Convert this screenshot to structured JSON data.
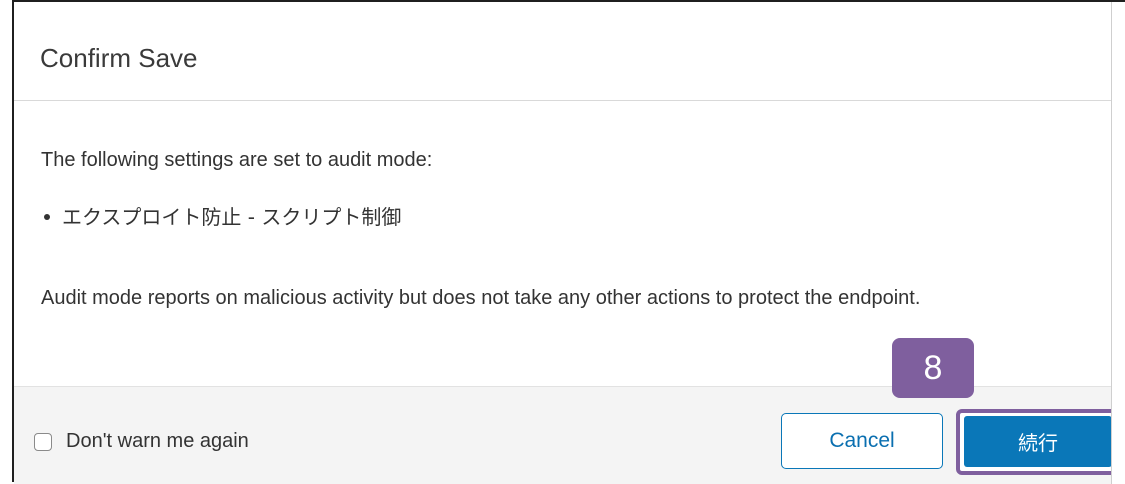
{
  "dialog": {
    "title": "Confirm Save",
    "intro": "The following settings are set to audit mode:",
    "items": [
      "エクスプロイト防止 - スクリプト制御"
    ],
    "note": "Audit mode reports on malicious activity but does not take any other actions to protect the endpoint."
  },
  "footer": {
    "checkbox_label": "Don't warn me again",
    "checkbox_checked": false,
    "cancel_label": "Cancel",
    "continue_label": "続行"
  },
  "annotation": {
    "step_number": "8"
  },
  "colors": {
    "primary_button": "#0a77b8",
    "highlight": "#7f5f9e"
  }
}
